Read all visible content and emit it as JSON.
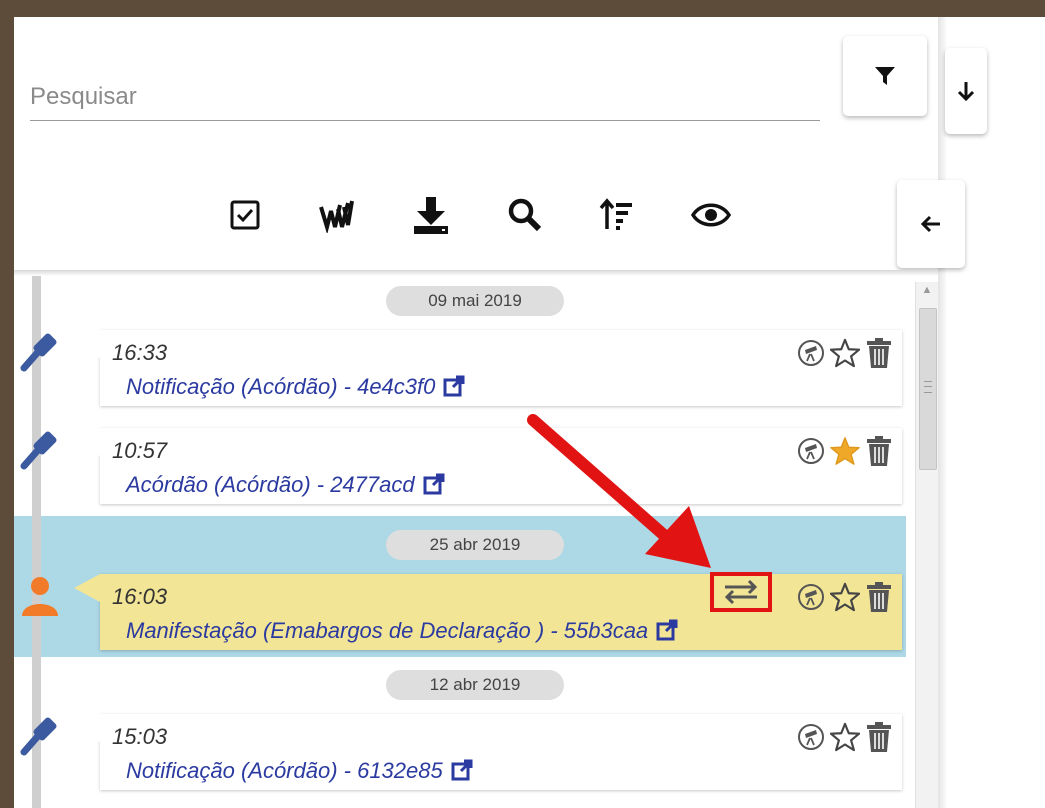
{
  "search": {
    "placeholder": "Pesquisar"
  },
  "toolbar": {
    "buttons": [
      {
        "icon": "checkbox-icon",
        "tooltip": ""
      },
      {
        "icon": "document-stack-icon",
        "tooltip": ""
      },
      {
        "icon": "download-icon",
        "tooltip": ""
      },
      {
        "icon": "search-icon",
        "tooltip": ""
      },
      {
        "icon": "sort-icon",
        "tooltip": ""
      },
      {
        "icon": "eye-icon",
        "tooltip": ""
      }
    ],
    "filter_icon": "filter-icon",
    "sort_direction_icon": "arrow-down-icon",
    "collapse_icon": "arrow-left-icon"
  },
  "timeline": {
    "groups": [
      {
        "date": "09 mai 2019",
        "items": [
          {
            "time": "16:33",
            "title": "Notificação (Acórdão) - 4e4c3f0",
            "type_icon": "gavel-icon",
            "starred": false,
            "highlighted": false
          },
          {
            "time": "10:57",
            "title": "Acórdão (Acórdão) - 2477acd",
            "type_icon": "gavel-icon",
            "starred": true,
            "highlighted": false
          }
        ]
      },
      {
        "date": "25 abr 2019",
        "items": [
          {
            "time": "16:03",
            "title": "Manifestação (Emabargos de Declaração ) - 55b3caa",
            "type_icon": "person-icon",
            "starred": false,
            "highlighted": true
          }
        ]
      },
      {
        "date": "12 abr 2019",
        "items": [
          {
            "time": "15:03",
            "title": "Notificação (Acórdão) - 6132e85",
            "type_icon": "gavel-icon",
            "starred": false,
            "highlighted": false
          }
        ]
      }
    ]
  },
  "colors": {
    "frame": "#5e4c3a",
    "link": "#2b3aa0",
    "highlight_band": "#add8e6",
    "highlight_card": "#f3e596",
    "star_active": "#f0a828",
    "person_icon": "#f27b2a",
    "gavel_icon": "#3b5aa0",
    "annotation_red": "#e11313"
  }
}
